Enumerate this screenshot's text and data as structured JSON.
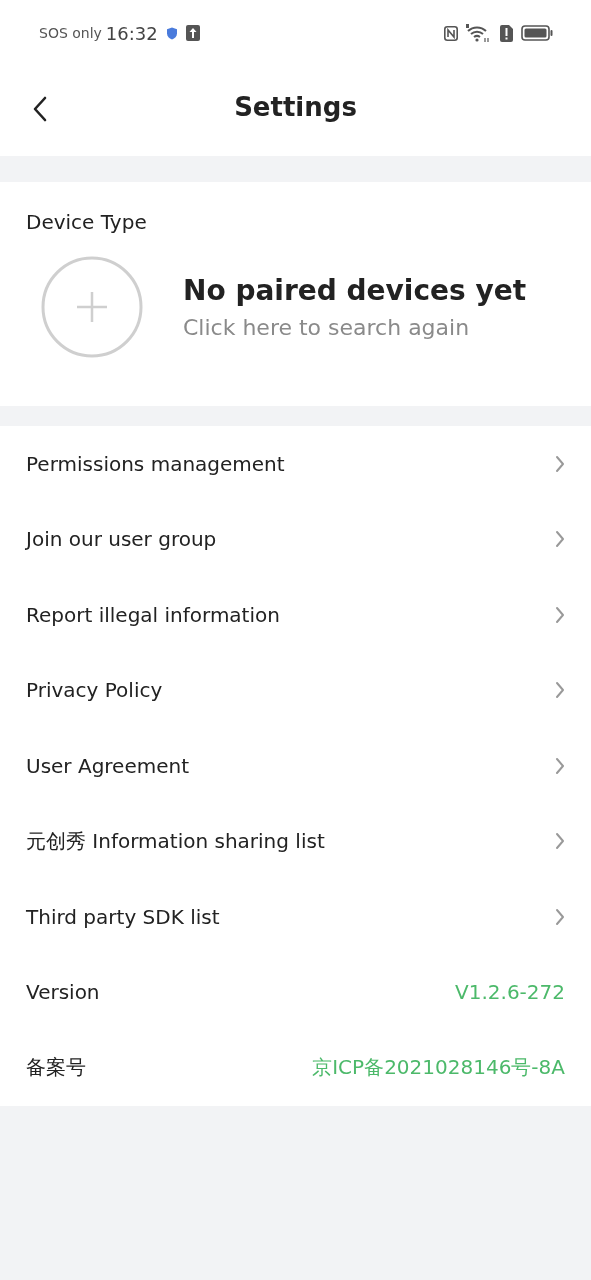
{
  "status_bar": {
    "carrier": "SOS only",
    "time": "16:32"
  },
  "header": {
    "title": "Settings"
  },
  "device": {
    "label": "Device Type",
    "title": "No paired devices yet",
    "subtitle": "Click here to search again"
  },
  "rows": [
    {
      "kind": "link",
      "label": "Permissions management"
    },
    {
      "kind": "link",
      "label": "Join our user group"
    },
    {
      "kind": "link",
      "label": "Report illegal information"
    },
    {
      "kind": "link",
      "label": "Privacy Policy"
    },
    {
      "kind": "link",
      "label": "User Agreement"
    },
    {
      "kind": "link",
      "label": "元创秀 Information sharing list"
    },
    {
      "kind": "link",
      "label": "Third party SDK list"
    },
    {
      "kind": "info",
      "label": "Version",
      "value": "V1.2.6-272"
    },
    {
      "kind": "info",
      "label": "备案号",
      "value": "京ICP备2021028146号-8A"
    }
  ]
}
